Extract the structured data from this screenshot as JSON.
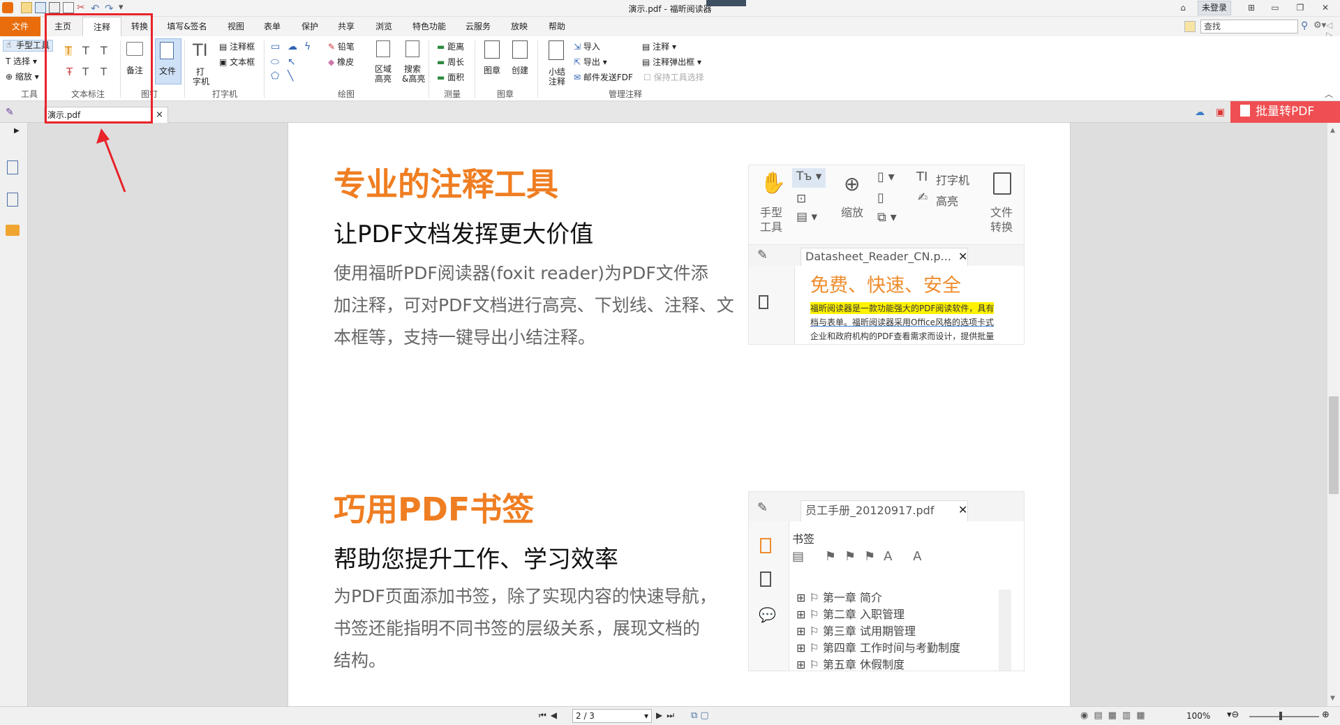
{
  "window": {
    "title": "演示.pdf - 福昕阅读器",
    "login": "未登录",
    "search_placeholder": "查找"
  },
  "menu_tabs": [
    "文件",
    "主页",
    "注释",
    "转换",
    "填写&签名",
    "视图",
    "表单",
    "保护",
    "共享",
    "浏览",
    "特色功能",
    "云服务",
    "放映",
    "帮助"
  ],
  "ribbon": {
    "tools": {
      "hand": "手型工具",
      "select": "选择",
      "zoom": "缩放",
      "group": "工具"
    },
    "text_markup": {
      "group": "文本标注"
    },
    "pin": {
      "note": "备注",
      "file": "文件",
      "group": "图钉"
    },
    "typewriter": {
      "big_line1": "打",
      "big_line2": "字机",
      "callout": "注释框",
      "textbox": "文本框",
      "group": "打字机"
    },
    "drawing": {
      "pencil": "铅笔",
      "eraser": "橡皮",
      "area_hl_1": "区域",
      "area_hl_2": "高亮",
      "search_hl_1": "搜索",
      "search_hl_2": "&高亮",
      "group": "绘图"
    },
    "measure": {
      "distance": "距离",
      "perimeter": "周长",
      "area": "面积",
      "group": "测量"
    },
    "stamp": {
      "stamp": "图章",
      "create": "创建",
      "group": "图章"
    },
    "manage": {
      "summary_1": "小结",
      "summary_2": "注释",
      "import": "导入",
      "export": "导出",
      "email": "邮件发送FDF",
      "annot": "注释",
      "popup": "注释弹出框",
      "keep": "保持工具选择",
      "group": "管理注释"
    }
  },
  "doc_tab": {
    "name": "演示.pdf",
    "close": "×"
  },
  "batch_button": "批量转PDF",
  "page": {
    "s1": {
      "heading": "专业的注释工具",
      "sub": "让PDF文档发挥更大价值",
      "p1": "使用福昕PDF阅读器(foxit reader)为PDF文件添",
      "p2": "加注释，可对PDF文档进行高亮、下划线、注释、文",
      "p3": "本框等，支持一键导出小结注释。"
    },
    "shot1": {
      "hand_1": "手型",
      "hand_2": "工具",
      "zoom": "缩放",
      "typewriter": "打字机",
      "highlight": "高亮",
      "conv_1": "文件",
      "conv_2": "转换",
      "tab": "Datasheet_Reader_CN.p...",
      "title": "免费、快速、安全",
      "l1": "福昕阅读器是一款功能强大的PDF阅读软件，具有",
      "l2": "档与表单。福昕阅读器采用Office风格的选项卡式",
      "l3": "企业和政府机构的PDF查看需求而设计，提供批量"
    },
    "s2": {
      "heading": "巧用PDF书签",
      "sub": "帮助您提升工作、学习效率",
      "p1": "为PDF页面添加书签，除了实现内容的快速导航，",
      "p2": "书签还能指明不同书签的层级关系，展现文档的",
      "p3": "结构。"
    },
    "shot2": {
      "tab": "员工手册_20120917.pdf",
      "panel": "书签",
      "items": [
        "第一章  简介",
        "第二章  入职管理",
        "第三章  试用期管理",
        "第四章  工作时间与考勤制度",
        "第五章  休假制度"
      ]
    }
  },
  "status": {
    "page": "2 / 3",
    "zoom": "100%"
  },
  "colors": {
    "accent": "#e96d0d",
    "heading": "#ef7e22",
    "batch": "#ef4f52",
    "highlight_box": "#e8232a"
  }
}
